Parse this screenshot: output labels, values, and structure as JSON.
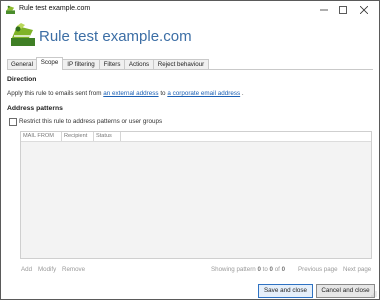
{
  "window": {
    "title": "Rule test example.com"
  },
  "header": {
    "title": "Rule test example.com"
  },
  "tabs": [
    "General",
    "Scope",
    "IP filtering",
    "Filters",
    "Actions",
    "Reject behaviour"
  ],
  "direction": {
    "heading": "Direction",
    "prefix": "Apply this rule to emails sent from",
    "from_link": "an external address",
    "to_word": "to",
    "to_link": "a corporate email address",
    "suffix": "."
  },
  "address_patterns": {
    "heading": "Address patterns",
    "restrict_label": "Restrict this rule to address patterns or user groups",
    "columns": [
      "MAIL FROM",
      "Recipient",
      "Status"
    ],
    "actions": [
      "Add",
      "Modify",
      "Remove"
    ],
    "pager": {
      "showing_prefix": "Showing pattern",
      "from": "0",
      "to_word": "to",
      "to": "0",
      "of_word": "of",
      "total": "0",
      "prev": "Previous page",
      "next": "Next page"
    }
  },
  "buttons": {
    "save": "Save and close",
    "cancel": "Cancel and close"
  }
}
